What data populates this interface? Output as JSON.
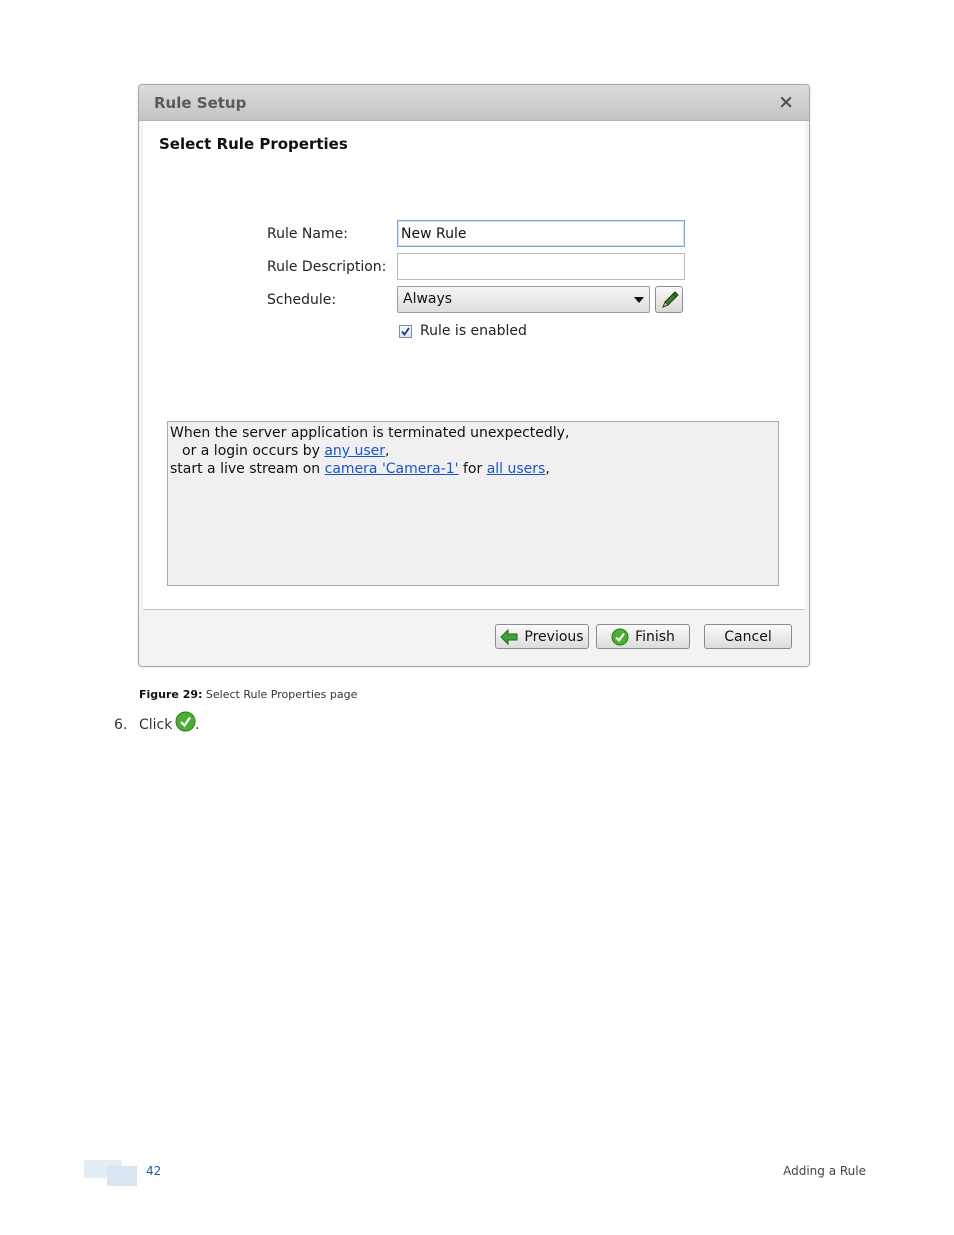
{
  "dialog": {
    "title": "Rule Setup",
    "close_glyph": "×",
    "heading": "Select Rule Properties",
    "fields": {
      "rule_name_label": "Rule Name:",
      "rule_name_value": "New Rule",
      "rule_description_label": "Rule Description:",
      "rule_description_value": "",
      "schedule_label": "Schedule:",
      "schedule_value": "Always",
      "enabled_label": "Rule is enabled",
      "enabled_checked": true
    },
    "summary": {
      "line1": "When the server application is terminated unexpectedly,",
      "line2_prefix": "or a login occurs by ",
      "line2_link": "any user",
      "line2_suffix": ",",
      "line3_prefix": "start a live stream on ",
      "line3_link1": "camera 'Camera-1'",
      "line3_middle": " for ",
      "line3_link2": "all users",
      "line3_suffix": ","
    },
    "buttons": {
      "previous": "Previous",
      "finish": "Finish",
      "cancel": "Cancel"
    },
    "icons": {
      "previous": "green-left-arrow-icon",
      "finish": "green-checkmark-icon",
      "edit_schedule": "pencil-icon"
    },
    "colors": {
      "link": "#1a55c8",
      "arrow_green": "#3da33d",
      "check_green": "#4caf35"
    }
  },
  "page": {
    "caption_label": "Figure 29:",
    "caption_text": " Select Rule Properties page",
    "step_number": "6.",
    "step_text": "Click",
    "step_period": ".",
    "page_number": "42",
    "section_title": "Adding a Rule"
  }
}
